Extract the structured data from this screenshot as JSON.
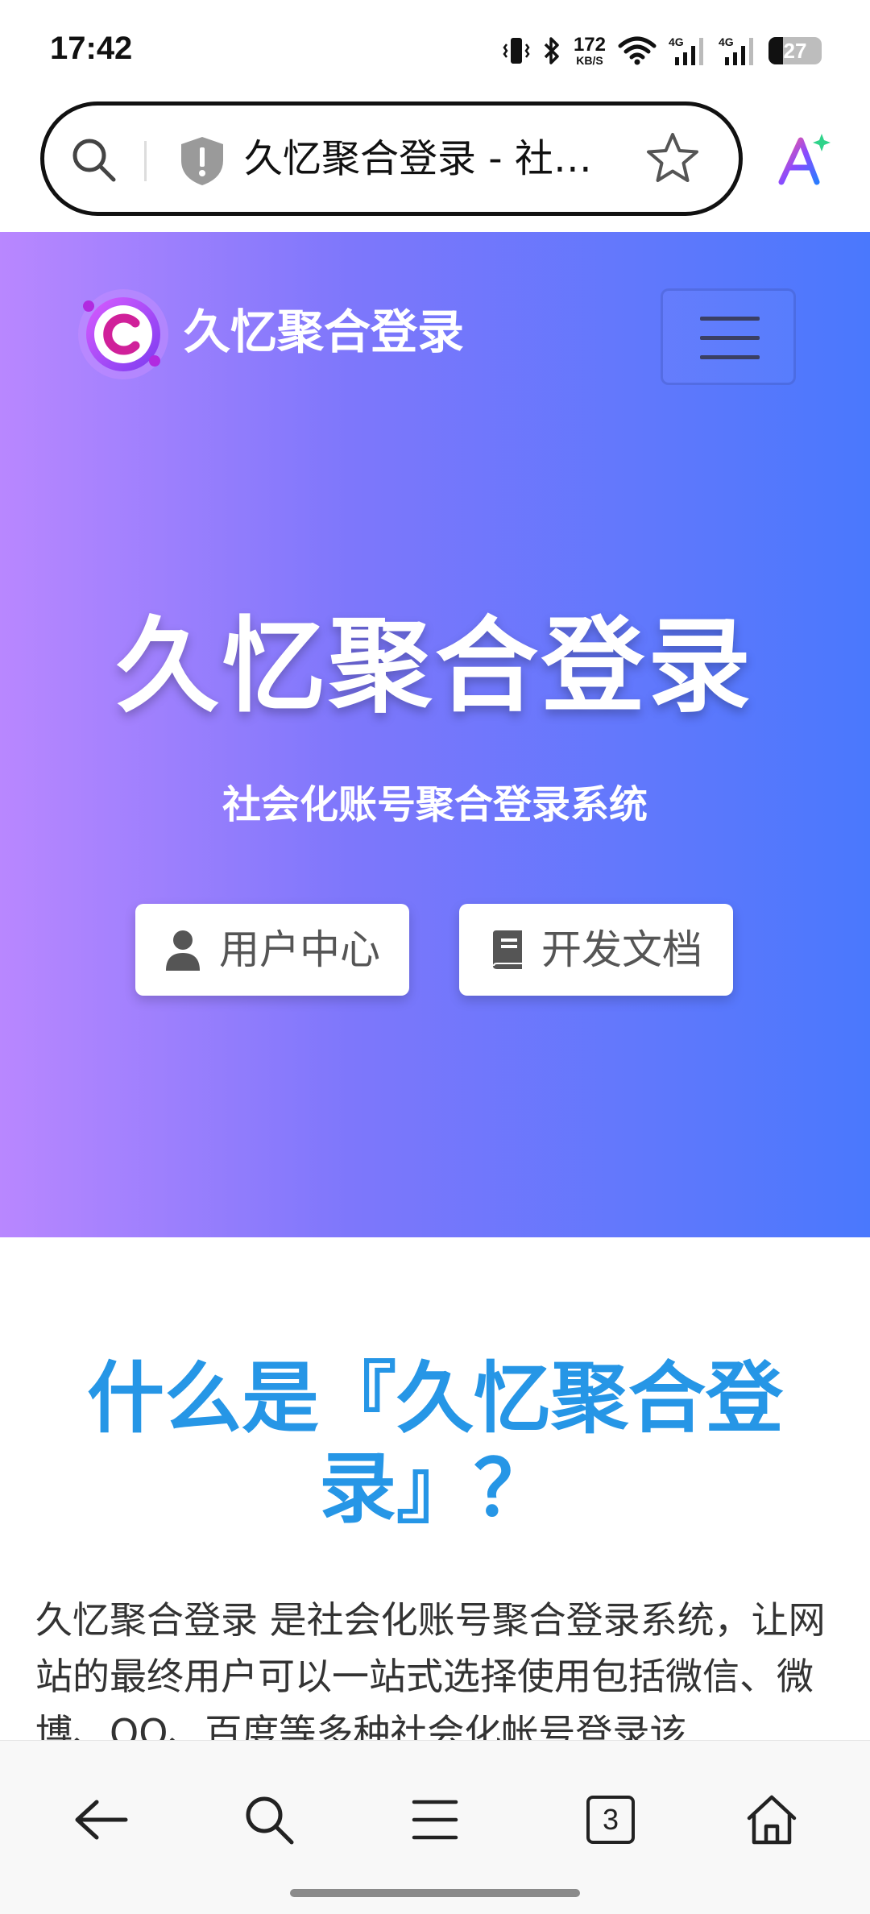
{
  "status_bar": {
    "time": "17:42",
    "net_speed_value": "172",
    "net_speed_unit": "KB/S",
    "signal_label_1": "4G",
    "signal_label_2": "4G",
    "battery_level": "27",
    "battery_fraction": 0.27,
    "icons": [
      "vibrate-icon",
      "bluetooth-icon",
      "wifi-icon",
      "signal-icon",
      "signal-icon",
      "battery-icon"
    ]
  },
  "browser": {
    "tab_title": "久忆聚合登录 - 社会化账号聚合登录系统",
    "tab_count": "3",
    "icons": [
      "search-icon",
      "shield-alert-icon",
      "star-icon",
      "ai-assistant-icon",
      "back-arrow-icon",
      "search-icon",
      "menu-icon",
      "tabs-icon",
      "home-icon"
    ]
  },
  "hero": {
    "brand_name": "久忆聚合登录",
    "title": "久忆聚合登录",
    "subtitle": "社会化账号聚合登录系统",
    "buttons": {
      "user_center": "用户中心",
      "dev_docs": "开发文档"
    }
  },
  "content": {
    "section_title": "什么是『久忆聚合登录』？",
    "intro": "久忆聚合登录 是社会化账号聚合登录系统，让网站的最终用户可以一站式选择使用包括微信、微博、QQ、百度等多种社会化帐号登录该"
  },
  "colors": {
    "hero_gradient_start": "#b987ff",
    "hero_gradient_end": "#4a78fd",
    "section_title": "#2696e6",
    "logo_accent": "#c02ad8"
  }
}
